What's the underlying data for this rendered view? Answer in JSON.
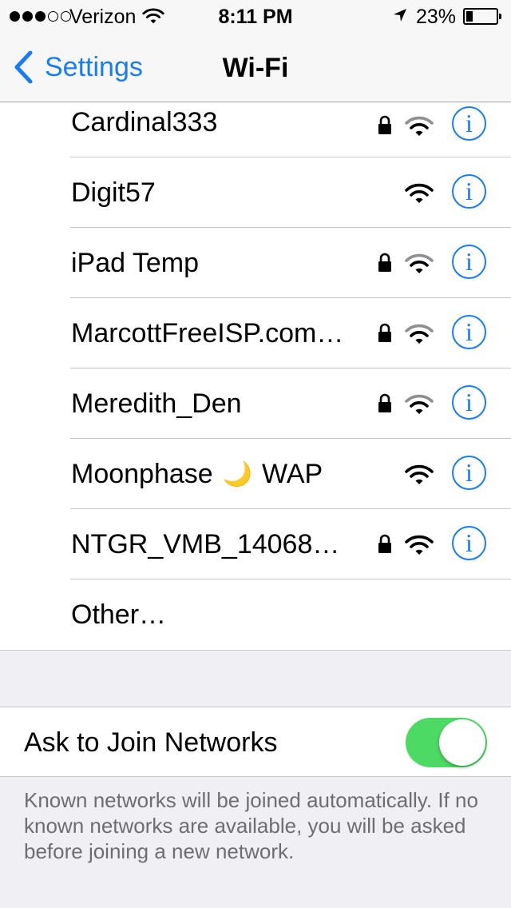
{
  "status_bar": {
    "signal_bars": 3,
    "signal_total": 5,
    "carrier": "Verizon",
    "time": "8:11 PM",
    "battery_text": "23%",
    "battery_level": 0.23
  },
  "nav": {
    "back_label": "Settings",
    "title": "Wi-Fi"
  },
  "networks": [
    {
      "name": "Cardinal333",
      "secured": true,
      "signal_icon": "wifi-icon"
    },
    {
      "name": "Digit57",
      "secured": false,
      "signal_icon": "wifi-icon"
    },
    {
      "name": "iPad Temp",
      "secured": true,
      "signal_icon": "wifi-icon"
    },
    {
      "name": "MarcottFreeISP.com…",
      "secured": true,
      "signal_icon": "wifi-icon"
    },
    {
      "name": "Meredith_Den",
      "secured": true,
      "signal_icon": "wifi-icon"
    },
    {
      "name_prefix": "Moonphase",
      "name_emoji": "🌙",
      "name_suffix": "WAP",
      "secured": false,
      "signal_icon": "wifi-icon"
    },
    {
      "name": "NTGR_VMB_14068…",
      "secured": true,
      "signal_icon": "wifi-icon"
    }
  ],
  "other_label": "Other…",
  "ask_to_join": {
    "label": "Ask to Join Networks",
    "enabled": true
  },
  "footnote": "Known networks will be joined automatically. If no known networks are available, you will be asked before joining a new network.",
  "colors": {
    "accent": "#1a7cf4",
    "toggle_on": "#4cd964",
    "background": "#efeff4"
  }
}
